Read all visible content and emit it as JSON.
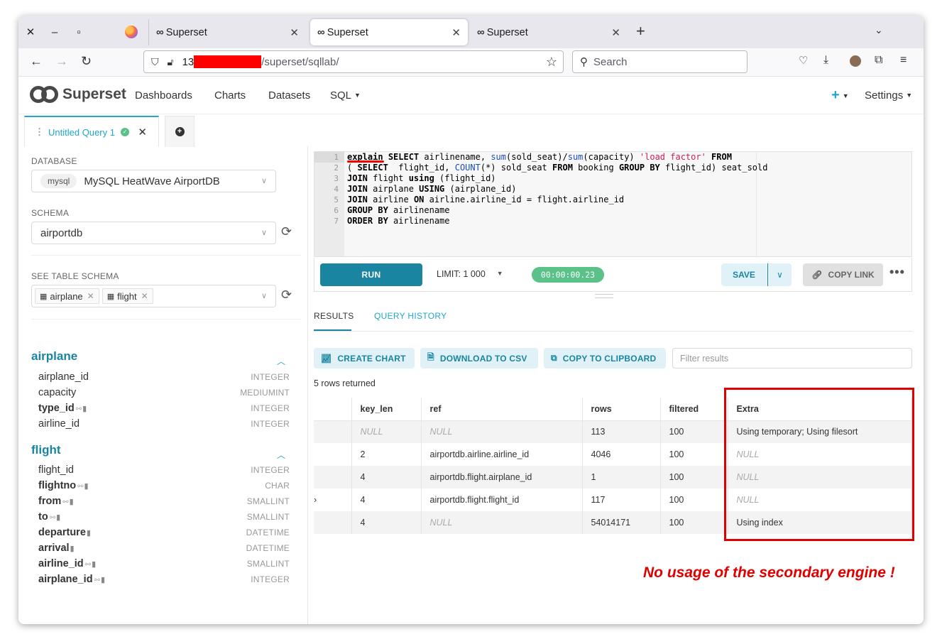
{
  "browser": {
    "tabs": [
      {
        "title": "Superset",
        "close": "✕",
        "active": false
      },
      {
        "title": "Superset",
        "close": "✕",
        "active": true
      },
      {
        "title": "Superset",
        "close": "✕",
        "active": false
      }
    ],
    "url_prefix": "13",
    "url_path": "/superset/sqllab/",
    "search_placeholder": "Search"
  },
  "app": {
    "brand": "Superset",
    "nav": [
      "Dashboards",
      "Charts",
      "Datasets",
      "SQL"
    ],
    "settings": "Settings"
  },
  "query_tab": {
    "title": "Untitled Query 1"
  },
  "left": {
    "database_label": "DATABASE",
    "database_tag": "mysql",
    "database_name": "MySQL HeatWave AirportDB",
    "schema_label": "SCHEMA",
    "schema_value": "airportdb",
    "see_table_label": "SEE TABLE SCHEMA",
    "selected_tables": [
      "airplane",
      "flight"
    ],
    "tables": [
      {
        "name": "airplane",
        "columns": [
          {
            "name": "airplane_id",
            "type": "INTEGER",
            "key": false
          },
          {
            "name": "capacity",
            "type": "MEDIUMINT",
            "key": false
          },
          {
            "name": "type_id",
            "type": "INTEGER",
            "key": true
          },
          {
            "name": "airline_id",
            "type": "INTEGER",
            "key": false
          }
        ]
      },
      {
        "name": "flight",
        "columns": [
          {
            "name": "flight_id",
            "type": "INTEGER",
            "key": false
          },
          {
            "name": "flightno",
            "type": "CHAR",
            "key": true
          },
          {
            "name": "from",
            "type": "SMALLINT",
            "key": true
          },
          {
            "name": "to",
            "type": "SMALLINT",
            "key": true
          },
          {
            "name": "departure",
            "type": "DATETIME",
            "key": true
          },
          {
            "name": "arrival",
            "type": "DATETIME",
            "key": true
          },
          {
            "name": "airline_id",
            "type": "SMALLINT",
            "key": true
          },
          {
            "name": "airplane_id",
            "type": "INTEGER",
            "key": true
          }
        ]
      }
    ]
  },
  "editor": {
    "line_numbers": [
      "1",
      "2",
      "3",
      "4",
      "5",
      "6",
      "7"
    ],
    "lines": [
      "explain SELECT airlinename, sum(sold_seat)/sum(capacity) 'load factor' FROM",
      "( SELECT  flight_id, COUNT(*) sold_seat FROM booking GROUP BY flight_id) seat_sold",
      "JOIN flight using (flight_id)",
      "JOIN airplane USING (airplane_id)",
      "JOIN airline ON airline.airline_id = flight.airline_id",
      "GROUP BY airlinename",
      "ORDER BY airlinename"
    ]
  },
  "controls": {
    "run": "RUN",
    "limit": "LIMIT:  1 000",
    "timer": "00:00:00.23",
    "save": "SAVE",
    "copy_link": "COPY LINK"
  },
  "results": {
    "tab_results": "RESULTS",
    "tab_history": "QUERY HISTORY",
    "create_chart": "CREATE CHART",
    "download_csv": "DOWNLOAD TO CSV",
    "copy_clipboard": "COPY TO CLIPBOARD",
    "filter_placeholder": "Filter results",
    "row_count": "5 rows returned",
    "columns": [
      "key_len",
      "ref",
      "rows",
      "filtered",
      "Extra"
    ],
    "rows": [
      {
        "lead": "",
        "key_len": "NULL",
        "ref": "NULL",
        "rows": "113",
        "filtered": "100",
        "extra": "Using temporary; Using filesort"
      },
      {
        "lead": "",
        "key_len": "2",
        "ref": "airportdb.airline.airline_id",
        "rows": "4046",
        "filtered": "100",
        "extra": "NULL"
      },
      {
        "lead": "",
        "key_len": "4",
        "ref": "airportdb.flight.airplane_id",
        "rows": "1",
        "filtered": "100",
        "extra": "NULL"
      },
      {
        "lead": "›",
        "key_len": "4",
        "ref": "airportdb.flight.flight_id",
        "rows": "117",
        "filtered": "100",
        "extra": "NULL"
      },
      {
        "lead": "",
        "key_len": "4",
        "ref": "NULL",
        "rows": "54014171",
        "filtered": "100",
        "extra": "Using index"
      }
    ]
  },
  "annotation": "No usage of the secondary engine !",
  "colors": {
    "accent": "#20a7c9",
    "run": "#1a85a0",
    "success": "#5ac189",
    "annotation": "#e00000"
  }
}
